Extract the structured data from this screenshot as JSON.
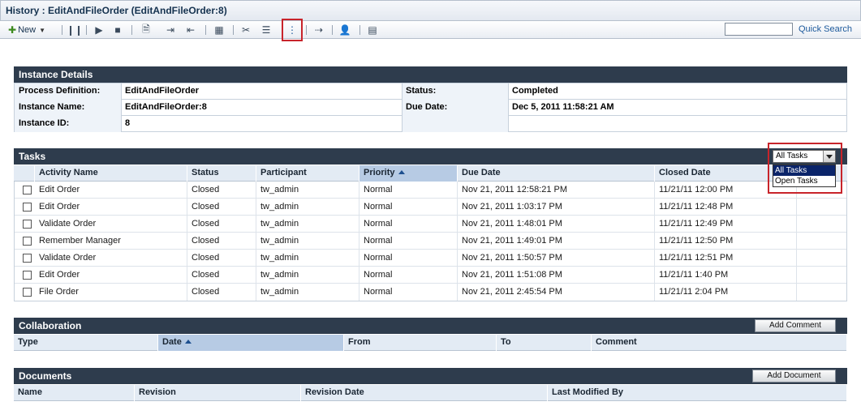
{
  "window": {
    "title": "History : EditAndFileOrder (EditAndFileOrder:8)"
  },
  "toolbar": {
    "new_label": "New",
    "quick_search_label": "Quick Search",
    "quick_search_value": "",
    "icons": [
      "pause-icon",
      "resume-icon",
      "stop-icon",
      "document-icon",
      "import-icon",
      "export-icon",
      "calendar-icon",
      "cut-icon",
      "list-icon",
      "tree-flow-icon",
      "move-icon",
      "user-icon",
      "report-icon"
    ]
  },
  "instance_details": {
    "header": "Instance Details",
    "process_definition_label": "Process Definition:",
    "process_definition": "EditAndFileOrder",
    "instance_name_label": "Instance Name:",
    "instance_name": "EditAndFileOrder:8",
    "instance_id_label": "Instance ID:",
    "instance_id": "8",
    "status_label": "Status:",
    "status": "Completed",
    "due_date_label": "Due Date:",
    "due_date": "Dec 5, 2011 11:58:21 AM"
  },
  "tasks": {
    "header": "Tasks",
    "filter": {
      "selected": "All Tasks",
      "options": [
        "All Tasks",
        "Open Tasks"
      ]
    },
    "columns": [
      "Activity Name",
      "Status",
      "Participant",
      "Priority",
      "Due Date",
      "Closed Date"
    ],
    "rows": [
      {
        "activity": "Edit Order",
        "status": "Closed",
        "participant": "tw_admin",
        "priority": "Normal",
        "due": "Nov 21, 2011 12:58:21 PM",
        "closed": "11/21/11 12:00 PM"
      },
      {
        "activity": "Edit Order",
        "status": "Closed",
        "participant": "tw_admin",
        "priority": "Normal",
        "due": "Nov 21, 2011 1:03:17 PM",
        "closed": "11/21/11 12:48 PM"
      },
      {
        "activity": "Validate Order",
        "status": "Closed",
        "participant": "tw_admin",
        "priority": "Normal",
        "due": "Nov 21, 2011 1:48:01 PM",
        "closed": "11/21/11 12:49 PM"
      },
      {
        "activity": "Remember Manager",
        "status": "Closed",
        "participant": "tw_admin",
        "priority": "Normal",
        "due": "Nov 21, 2011 1:49:01 PM",
        "closed": "11/21/11 12:50 PM"
      },
      {
        "activity": "Validate Order",
        "status": "Closed",
        "participant": "tw_admin",
        "priority": "Normal",
        "due": "Nov 21, 2011 1:50:57 PM",
        "closed": "11/21/11 12:51 PM"
      },
      {
        "activity": "Edit Order",
        "status": "Closed",
        "participant": "tw_admin",
        "priority": "Normal",
        "due": "Nov 21, 2011 1:51:08 PM",
        "closed": "11/21/11 1:40 PM"
      },
      {
        "activity": "File Order",
        "status": "Closed",
        "participant": "tw_admin",
        "priority": "Normal",
        "due": "Nov 21, 2011 2:45:54 PM",
        "closed": "11/21/11 2:04 PM"
      }
    ]
  },
  "collaboration": {
    "header": "Collaboration",
    "add_comment_label": "Add Comment",
    "columns": [
      "Type",
      "Date",
      "From",
      "To",
      "Comment"
    ]
  },
  "documents": {
    "header": "Documents",
    "add_document_label": "Add Document",
    "columns": [
      "Name",
      "Revision",
      "Revision Date",
      "Last Modified By"
    ]
  }
}
